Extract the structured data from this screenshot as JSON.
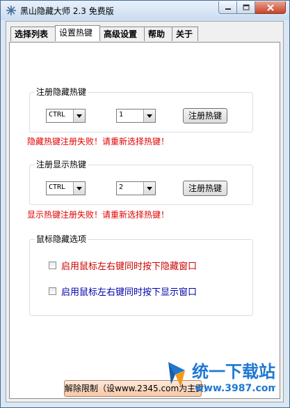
{
  "window": {
    "title": "黑山隐藏大师 2.3 免费版"
  },
  "tabs": [
    {
      "label": "选择列表"
    },
    {
      "label": "设置热键"
    },
    {
      "label": "高级设置"
    },
    {
      "label": "帮助"
    },
    {
      "label": "关于"
    }
  ],
  "hide_hotkey": {
    "group_label": "注册隐藏热键",
    "modifier": "CTRL",
    "key": "1",
    "register_label": "注册热键",
    "error": "隐藏热键注册失败！请重新选择热键！"
  },
  "show_hotkey": {
    "group_label": "注册显示热键",
    "modifier": "CTRL",
    "key": "2",
    "register_label": "注册热键",
    "error": "显示热键注册失败！请重新选择热键！"
  },
  "mouse_options": {
    "group_label": "鼠标隐藏选项",
    "hide_option": {
      "label": "启用鼠标左右键同时按下隐藏窗口",
      "checked": false,
      "color": "#cc0000"
    },
    "show_option": {
      "label": "启用鼠标左右键同时按下显示窗口",
      "checked": false,
      "color": "#0000aa"
    }
  },
  "unlock_button": {
    "label": "解除限制（设www.2345.com为主页）"
  },
  "watermark": {
    "brand": "统一下载站",
    "url": "www.3987.com"
  },
  "colors": {
    "error": "#e00000",
    "accent": "#1e78d2"
  }
}
